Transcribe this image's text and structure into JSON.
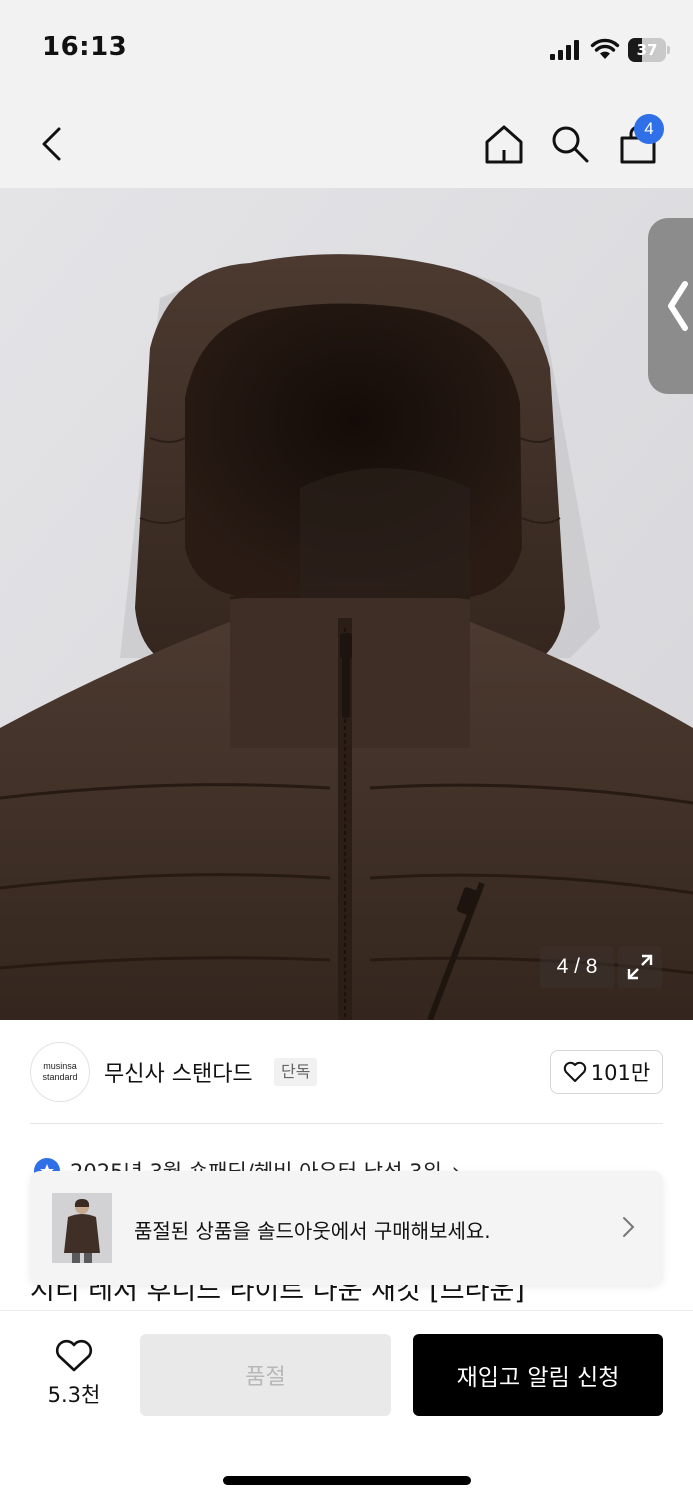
{
  "status_bar": {
    "time": "16:13",
    "battery_level": "37",
    "battery_fraction": 0.37
  },
  "nav": {
    "back_icon": "chevron-left-icon",
    "home_icon": "home-icon",
    "search_icon": "search-icon",
    "cart_icon": "shopping-bag-icon",
    "cart_count": "4",
    "badge_color": "#2f6fe8"
  },
  "gallery": {
    "counter": "4 / 8",
    "expand_icon": "expand-icon",
    "side_tab_icon": "chevron-left-icon"
  },
  "brand": {
    "logo_line1": "musinsa",
    "logo_line2": "standard",
    "name": "무신사 스탠다드",
    "tag": "단독",
    "like_count": "101만"
  },
  "product": {
    "ranking_text": "2025년 3월 숏패딩/헤비 아우터 남성 3위",
    "ranking_arrow": "›",
    "title": "시티 레저 후디드 라이트 다운 재킷 [브라운]"
  },
  "toast": {
    "message": "품절된 상품을 솔드아웃에서 구매해보세요."
  },
  "bottom_bar": {
    "wish_count": "5.3천",
    "soldout_label": "품절",
    "restock_label": "재입고 알림 신청"
  }
}
